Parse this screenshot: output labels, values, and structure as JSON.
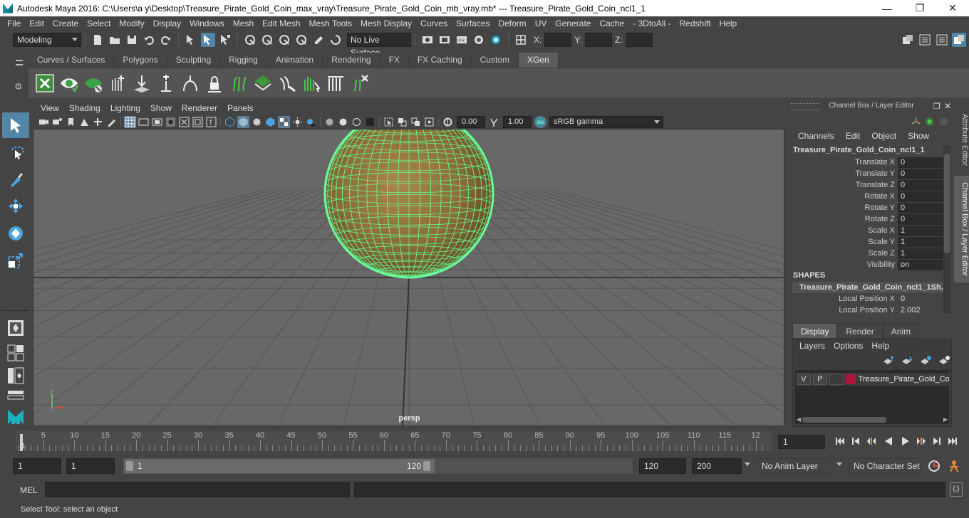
{
  "window": {
    "title": "Autodesk Maya 2016: C:\\Users\\a y\\Desktop\\Treasure_Pirate_Gold_Coin_max_vray\\Treasure_Pirate_Gold_Coin_mb_vray.mb*   ---   Treasure_Pirate_Gold_Coin_ncl1_1",
    "minimize": "—",
    "maximize": "❐",
    "close": "✕"
  },
  "menubar": [
    "File",
    "Edit",
    "Create",
    "Select",
    "Modify",
    "Display",
    "Windows",
    "Mesh",
    "Edit Mesh",
    "Mesh Tools",
    "Mesh Display",
    "Curves",
    "Surfaces",
    "Deform",
    "UV",
    "Generate",
    "Cache",
    "- 3DtoAll -",
    "Redshift",
    "Help"
  ],
  "statusline": {
    "mode": "Modeling",
    "live_surface": "No Live Surface",
    "x_label": "X:",
    "y_label": "Y:",
    "z_label": "Z:"
  },
  "shelf": {
    "tabs": [
      "Curves / Surfaces",
      "Polygons",
      "Sculpting",
      "Rigging",
      "Animation",
      "Rendering",
      "FX",
      "FX Caching",
      "Custom",
      "XGen"
    ],
    "active_tab": "XGen"
  },
  "panel": {
    "menus": [
      "View",
      "Shading",
      "Lighting",
      "Show",
      "Renderer",
      "Panels"
    ],
    "exposure": "0.00",
    "gamma": "1.00",
    "color_space": "sRGB gamma",
    "camera_label": "persp"
  },
  "channel_box": {
    "header": "Channel Box / Layer Editor",
    "menus": [
      "Channels",
      "Edit",
      "Object",
      "Show"
    ],
    "object_name": "Treasure_Pirate_Gold_Coin_ncl1_1",
    "attributes": [
      {
        "name": "Translate X",
        "value": "0"
      },
      {
        "name": "Translate Y",
        "value": "0"
      },
      {
        "name": "Translate Z",
        "value": "0"
      },
      {
        "name": "Rotate X",
        "value": "0"
      },
      {
        "name": "Rotate Y",
        "value": "0"
      },
      {
        "name": "Rotate Z",
        "value": "0"
      },
      {
        "name": "Scale X",
        "value": "1"
      },
      {
        "name": "Scale Y",
        "value": "1"
      },
      {
        "name": "Scale Z",
        "value": "1"
      },
      {
        "name": "Visibility",
        "value": "on"
      }
    ],
    "shapes_label": "SHAPES",
    "shape_name": "Treasure_Pirate_Gold_Coin_ncl1_1Sh...",
    "shape_attributes": [
      {
        "name": "Local Position X",
        "value": "0"
      },
      {
        "name": "Local Position Y",
        "value": "2.002"
      }
    ]
  },
  "side_tabs": {
    "attribute_editor": "Attribute Editor",
    "channel_box": "Channel Box / Layer Editor"
  },
  "layer_editor": {
    "tabs": [
      "Display",
      "Render",
      "Anim"
    ],
    "active_tab": "Display",
    "menus": [
      "Layers",
      "Options",
      "Help"
    ],
    "layer": {
      "v": "V",
      "p": "P",
      "name": "Treasure_Pirate_Gold_Co",
      "color": "#b0163a"
    }
  },
  "timeslider": {
    "labels": [
      "5",
      "10",
      "15",
      "20",
      "25",
      "30",
      "35",
      "40",
      "45",
      "50",
      "55",
      "60",
      "65",
      "70",
      "75",
      "80",
      "85",
      "90",
      "95",
      "100",
      "105",
      "110",
      "115",
      "12"
    ],
    "current_frame": "1",
    "current_field": "1"
  },
  "range": {
    "start": "1",
    "playback_start": "1",
    "slider_start": "1",
    "slider_end": "120",
    "playback_end": "120",
    "end": "200",
    "anim_layer": "No Anim Layer",
    "character_set": "No Character Set"
  },
  "commandline": {
    "label": "MEL"
  },
  "helpline": "Select Tool: select an object",
  "colors": {
    "wireframe": "#66ff99",
    "selection": "#5285a6",
    "layer_color": "#b0163a"
  }
}
